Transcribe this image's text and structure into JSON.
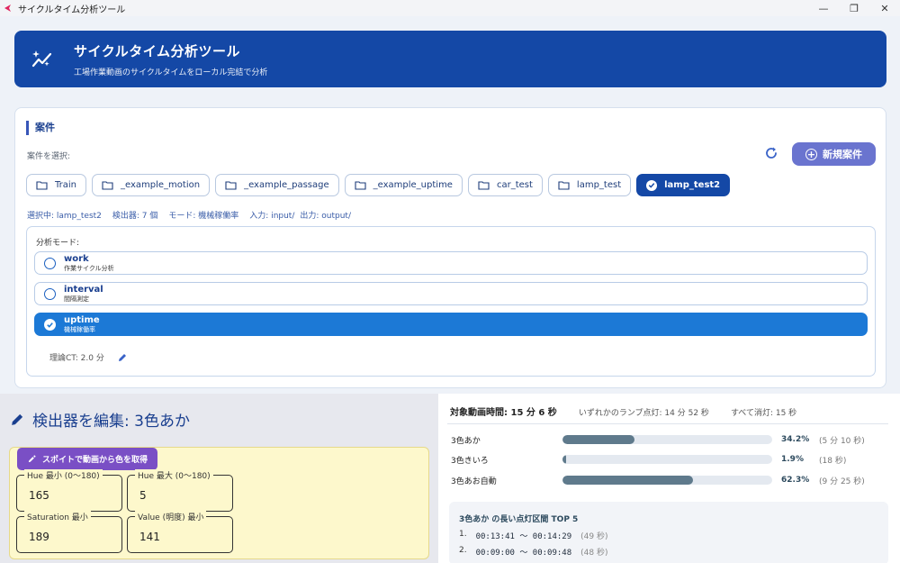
{
  "window": {
    "title": "サイクルタイム分析ツール"
  },
  "header": {
    "title": "サイクルタイム分析ツール",
    "subtitle": "工場作業動画のサイクルタイムをローカル完結で分析"
  },
  "project": {
    "section_title": "案件",
    "select_label": "案件を選択:",
    "new_button": "新規案件",
    "chips": [
      {
        "label": "Train",
        "active": false
      },
      {
        "label": "_example_motion",
        "active": false
      },
      {
        "label": "_example_passage",
        "active": false
      },
      {
        "label": "_example_uptime",
        "active": false
      },
      {
        "label": "car_test",
        "active": false
      },
      {
        "label": "lamp_test",
        "active": false
      },
      {
        "label": "lamp_test2",
        "active": true
      }
    ],
    "info": {
      "selected": "選択中: lamp_test2",
      "detectors": "検出器: 7 個",
      "mode": "モード: 機械稼働率",
      "input": "入力: input/",
      "output": "出力: output/"
    },
    "mode_label": "分析モード:",
    "modes": [
      {
        "name": "work",
        "desc": "作業サイクル分析",
        "selected": false
      },
      {
        "name": "interval",
        "desc": "間隔測定",
        "selected": false
      },
      {
        "name": "uptime",
        "desc": "機械稼働率",
        "selected": true
      }
    ],
    "theoretical_ct": "理論CT: 2.0 分"
  },
  "detector": {
    "title": "検出器を編集: 3色あか",
    "dropper_button": "スポイトで動画から色を取得",
    "fields": {
      "hue_min": {
        "label": "Hue 最小 (0〜180)",
        "value": "165"
      },
      "hue_max": {
        "label": "Hue 最大 (0〜180)",
        "value": "5"
      },
      "sat_min": {
        "label": "Saturation 最小",
        "value": "189"
      },
      "val_min": {
        "label": "Value (明度) 最小",
        "value": "141"
      }
    }
  },
  "stats": {
    "total": "対象動画時間: 15 分 6 秒",
    "any_on": "いずれかのランプ点灯: 14 分 52 秒",
    "all_off": "すべて消灯: 15 秒",
    "bars": [
      {
        "name": "3色あか",
        "pct_value": 34.2,
        "pct": "34.2%",
        "dur": "(5 分 10 秒)"
      },
      {
        "name": "3色きいろ",
        "pct_value": 1.9,
        "pct": "1.9%",
        "dur": "(18 秒)"
      },
      {
        "name": "3色あお自動",
        "pct_value": 62.3,
        "pct": "62.3%",
        "dur": "(9 分 25 秒)"
      }
    ],
    "bar_color": "#5f7a8c",
    "top5": {
      "title": "3色あか の長い点灯区間 TOP 5",
      "items": [
        {
          "no": "1.",
          "range": "00:13:41 〜 00:14:29",
          "sec": "(49 秒)"
        },
        {
          "no": "2.",
          "range": "00:09:00 〜 00:09:48",
          "sec": "(48 秒)"
        }
      ]
    }
  },
  "colors": {
    "primary": "#1448a6",
    "accent": "#6a74cf",
    "active_mode": "#1c79d6",
    "dropper": "#7a4fc5"
  }
}
